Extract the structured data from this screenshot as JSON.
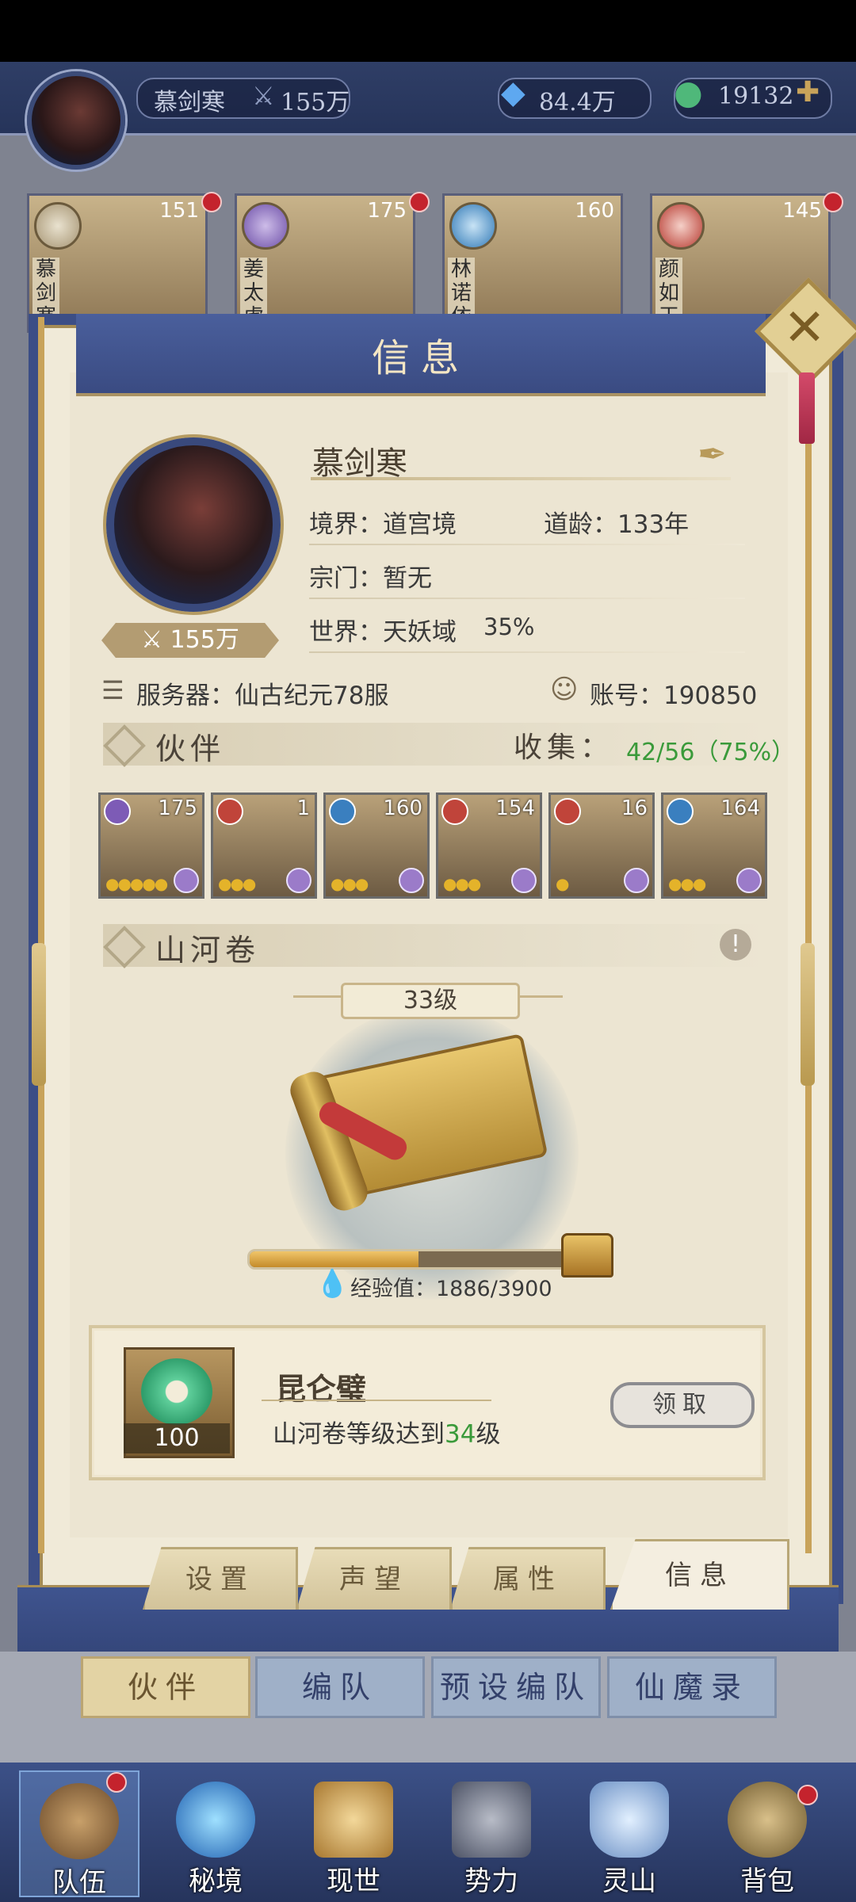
{
  "hud": {
    "player_name": "慕剑寒",
    "power": "155万",
    "spirit_stone": "84.4万",
    "jade": "19132"
  },
  "heroes": [
    {
      "name": "慕剑寒",
      "level": "151"
    },
    {
      "name": "姜太虚",
      "level": "175"
    },
    {
      "name": "林诺依",
      "level": "160"
    },
    {
      "name": "颜如玉",
      "level": "145"
    }
  ],
  "dialog": {
    "title": "信息",
    "player_name": "慕剑寒",
    "realm_label": "境界：道宫境",
    "age_label": "道龄：133年",
    "sect_label": "宗门：暂无",
    "world_label": "世界：天妖域",
    "world_progress": "35%",
    "power": "155万",
    "server_label": "服务器：仙古纪元78服",
    "account_label": "账号：190850"
  },
  "partners_section": {
    "title": "伙伴",
    "collect_label": "收集：",
    "collect_value": "42/56（75%）",
    "partners": [
      {
        "level": "175",
        "element_color": "#7d5bb6",
        "stars": 5
      },
      {
        "level": "1",
        "element_color": "#c0443a",
        "stars": 3
      },
      {
        "level": "160",
        "element_color": "#3a7fbf",
        "stars": 3
      },
      {
        "level": "154",
        "element_color": "#c0443a",
        "stars": 3
      },
      {
        "level": "16",
        "element_color": "#c0443a",
        "stars": 1
      },
      {
        "level": "164",
        "element_color": "#3a7fbf",
        "stars": 3
      }
    ]
  },
  "scroll_section": {
    "title": "山河卷",
    "level": "33级",
    "xp_label": "经验值：1886/3900",
    "xp_fraction": 0.4836
  },
  "reward": {
    "name": "昆仑璧",
    "count": "100",
    "desc_prefix": "山河卷等级达到",
    "desc_level": "34",
    "desc_suffix": "级",
    "claim_label": "领取"
  },
  "tabs": [
    "设置",
    "声望",
    "属性",
    "信息"
  ],
  "subtabs": [
    "伙伴",
    "编队",
    "预设编队",
    "仙魔录"
  ],
  "bottom_nav": [
    "队伍",
    "秘境",
    "现世",
    "势力",
    "灵山",
    "背包"
  ],
  "colors": {
    "accent_navy": "#3c4e86",
    "gold": "#c8a35a",
    "collect_green": "#3a9a3a",
    "badge_red": "#c4232d"
  }
}
